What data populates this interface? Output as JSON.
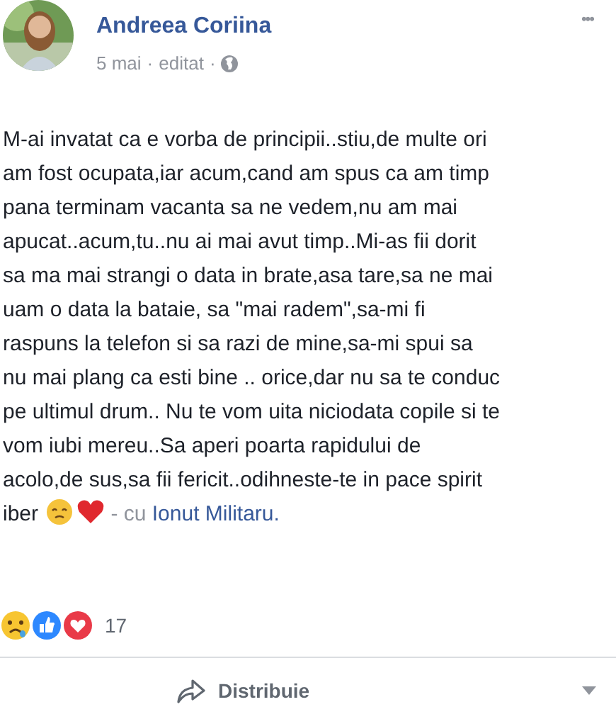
{
  "post": {
    "author": "Andreea Coriina",
    "date": "5 mai",
    "edited": "editat",
    "separator": "·",
    "more": "•••",
    "lines": [
      "M-ai invatat ca e vorba de principii..stiu,de multe ori",
      "am fost ocupata,iar acum,cand am spus ca am timp",
      "pana terminam vacanta sa ne vedem,nu am mai",
      "apucat..acum,tu..nu ai mai avut timp..Mi-as fii dorit",
      "sa ma mai strangi o data in brate,asa tare,sa ne mai",
      "uam o data la bataie, sa \"mai radem\",sa-mi fi",
      "raspuns la telefon si sa razi de mine,sa-mi spui sa",
      "nu mai plang ca esti bine .. orice,dar nu sa te conduc",
      "pe ultimul drum.. Nu te vom uita niciodata copile si te",
      "vom iubi mereu..Sa aperi poarta rapidului de",
      "acolo,de sus,sa fii fericit..odihneste-te in pace spirit",
      "iber"
    ],
    "with_text": "- cu",
    "tagged": "Ionut Militaru",
    "end": ".",
    "reaction_count": "17",
    "share": "Distribuie"
  }
}
